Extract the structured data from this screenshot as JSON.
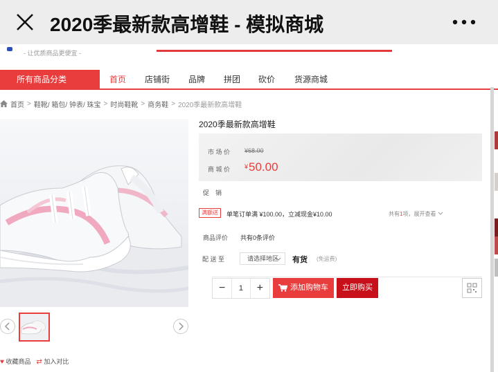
{
  "window": {
    "title": "2020季最新款高增鞋 - 模拟商城"
  },
  "header": {
    "slogan": "- 让优质商品更便宜 -"
  },
  "nav": {
    "all_categories": "所有商品分类",
    "items": [
      "首页",
      "店铺街",
      "品牌",
      "拼团",
      "砍价",
      "货源商城"
    ]
  },
  "breadcrumb": {
    "home": "首页",
    "items": [
      "鞋靴/ 箱包/ 钟表/ 珠宝",
      "时尚鞋靴",
      "商务鞋",
      "2020季最新款高增鞋"
    ]
  },
  "product": {
    "name": "2020季最新款高增鞋",
    "market_label": "市 场 价",
    "market_price": "¥68.00",
    "shop_label": "商 城 价",
    "currency": "¥",
    "price": "50.00",
    "promo_label": "促　销",
    "promo_badge": "满额送",
    "promo_text": "单笔订单满 ¥100.00，立减现金¥10.00",
    "promo_more_prefix": "共有",
    "promo_more_count": "1",
    "promo_more_suffix": "项，展开查看",
    "review_label": "商品评价",
    "review_value": "共有0条评价",
    "ship_label": "配 送 至",
    "region_placeholder": "请选择地区",
    "stock": "有货",
    "freight": "(免运费)",
    "quantity": "1",
    "add_to_cart": "添加购物车",
    "buy_now": "立即购买"
  },
  "gallery": {
    "favorite": "收藏商品",
    "compare": "加入对比"
  },
  "colors": {
    "accent": "#e93c3c",
    "buy": "#c8101a"
  }
}
